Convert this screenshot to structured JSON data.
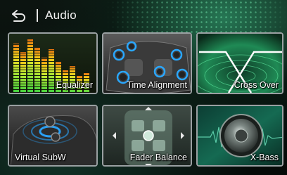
{
  "header": {
    "back_icon": "back-arrow-icon",
    "title": "Audio"
  },
  "tiles": [
    {
      "label": "Equalizer",
      "icon": "equalizer-icon"
    },
    {
      "label": "Time Alignment",
      "icon": "speakers-car-icon"
    },
    {
      "label": "Cross Over",
      "icon": "crossover-curve-icon"
    },
    {
      "label": "Virtual SubW",
      "icon": "subwoofer-car-icon"
    },
    {
      "label": "Fader Balance",
      "icon": "fader-balance-icon"
    },
    {
      "label": "X-Bass",
      "icon": "speaker-cone-icon"
    }
  ],
  "colors": {
    "accent_green": "#3be08a",
    "highlight_blue": "#2aa7ff",
    "tile_border": "#9aa0a2"
  }
}
